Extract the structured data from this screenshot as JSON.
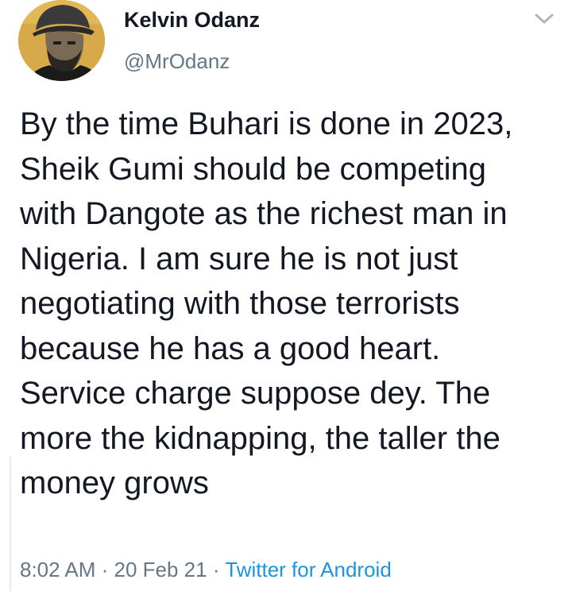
{
  "tweet": {
    "display_name": "Kelvin Odanz",
    "handle": "@MrOdanz",
    "text": "By the time Buhari is done in 2023, Sheik Gumi should be competing with Dangote as the richest man in Nigeria. I am sure he is not just negotiating with those terrorists because he has a good heart. Service charge suppose dey. The more the kidnapping, the taller the money grows",
    "time": "8:02 AM",
    "separator_1": " · ",
    "date": "20 Feb 21",
    "separator_2": " · ",
    "source": "Twitter for Android"
  },
  "icons": {
    "caret": "chevron-down-icon",
    "avatar": "avatar"
  },
  "colors": {
    "text_primary": "#141823",
    "text_secondary": "#657786",
    "link": "#1b95e0",
    "avatar_bg": "#d8a948"
  }
}
